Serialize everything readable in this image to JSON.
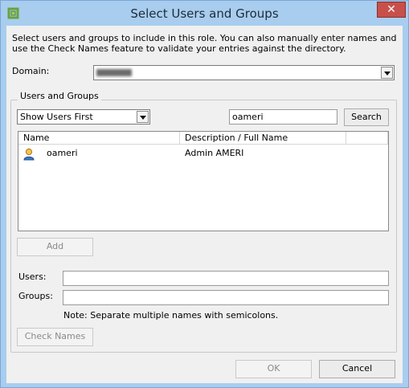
{
  "window": {
    "title": "Select Users and Groups",
    "close_glyph": "✕"
  },
  "intro_text": "Select users and groups to include in this role. You can also manually enter names and use the Check Names feature to validate your entries against the directory.",
  "domain": {
    "label": "Domain:",
    "value": "",
    "value_redacted": true
  },
  "group": {
    "legend": "Users and Groups",
    "sort_select_value": "Show Users First",
    "search_value": "oameri",
    "search_button": "Search"
  },
  "table": {
    "columns": [
      "Name",
      "Description / Full Name"
    ],
    "rows": [
      {
        "icon": "user-icon",
        "name": "oameri",
        "description": "Admin AMERI"
      }
    ]
  },
  "add_button": "Add",
  "users": {
    "label": "Users:",
    "value": ""
  },
  "groups": {
    "label": "Groups:",
    "value": ""
  },
  "note": "Note: Separate multiple names with semicolons.",
  "check_names_button": "Check Names",
  "footer": {
    "ok": "OK",
    "cancel": "Cancel"
  },
  "colors": {
    "titlebar": "#a8cdee",
    "client": "#f0f0f0",
    "close": "#c7504a"
  }
}
